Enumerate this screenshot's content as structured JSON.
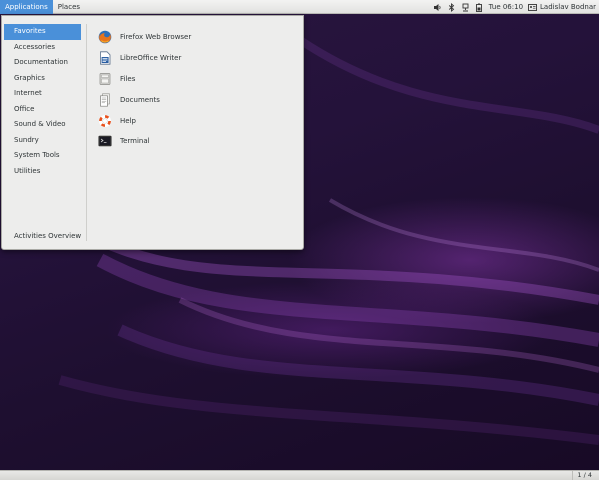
{
  "topbar": {
    "applications_label": "Applications",
    "places_label": "Places",
    "clock": "Tue 06:10",
    "user_name": "Ladislav Bodnar"
  },
  "menu": {
    "categories": [
      {
        "label": "Favorites"
      },
      {
        "label": "Accessories"
      },
      {
        "label": "Documentation"
      },
      {
        "label": "Graphics"
      },
      {
        "label": "Internet"
      },
      {
        "label": "Office"
      },
      {
        "label": "Sound & Video"
      },
      {
        "label": "Sundry"
      },
      {
        "label": "System Tools"
      },
      {
        "label": "Utilities"
      }
    ],
    "activities_label": "Activities Overview",
    "apps": [
      {
        "label": "Firefox Web Browser",
        "icon": "firefox-icon"
      },
      {
        "label": "LibreOffice Writer",
        "icon": "libreoffice-writer-icon"
      },
      {
        "label": "Files",
        "icon": "files-icon"
      },
      {
        "label": "Documents",
        "icon": "documents-icon"
      },
      {
        "label": "Help",
        "icon": "help-icon"
      },
      {
        "label": "Terminal",
        "icon": "terminal-icon"
      }
    ]
  },
  "bottombar": {
    "workspace_indicator": "1 / 4"
  },
  "colors": {
    "accent": "#4a90d9",
    "menu_background": "#ededec",
    "wallpaper": "#24123a"
  }
}
